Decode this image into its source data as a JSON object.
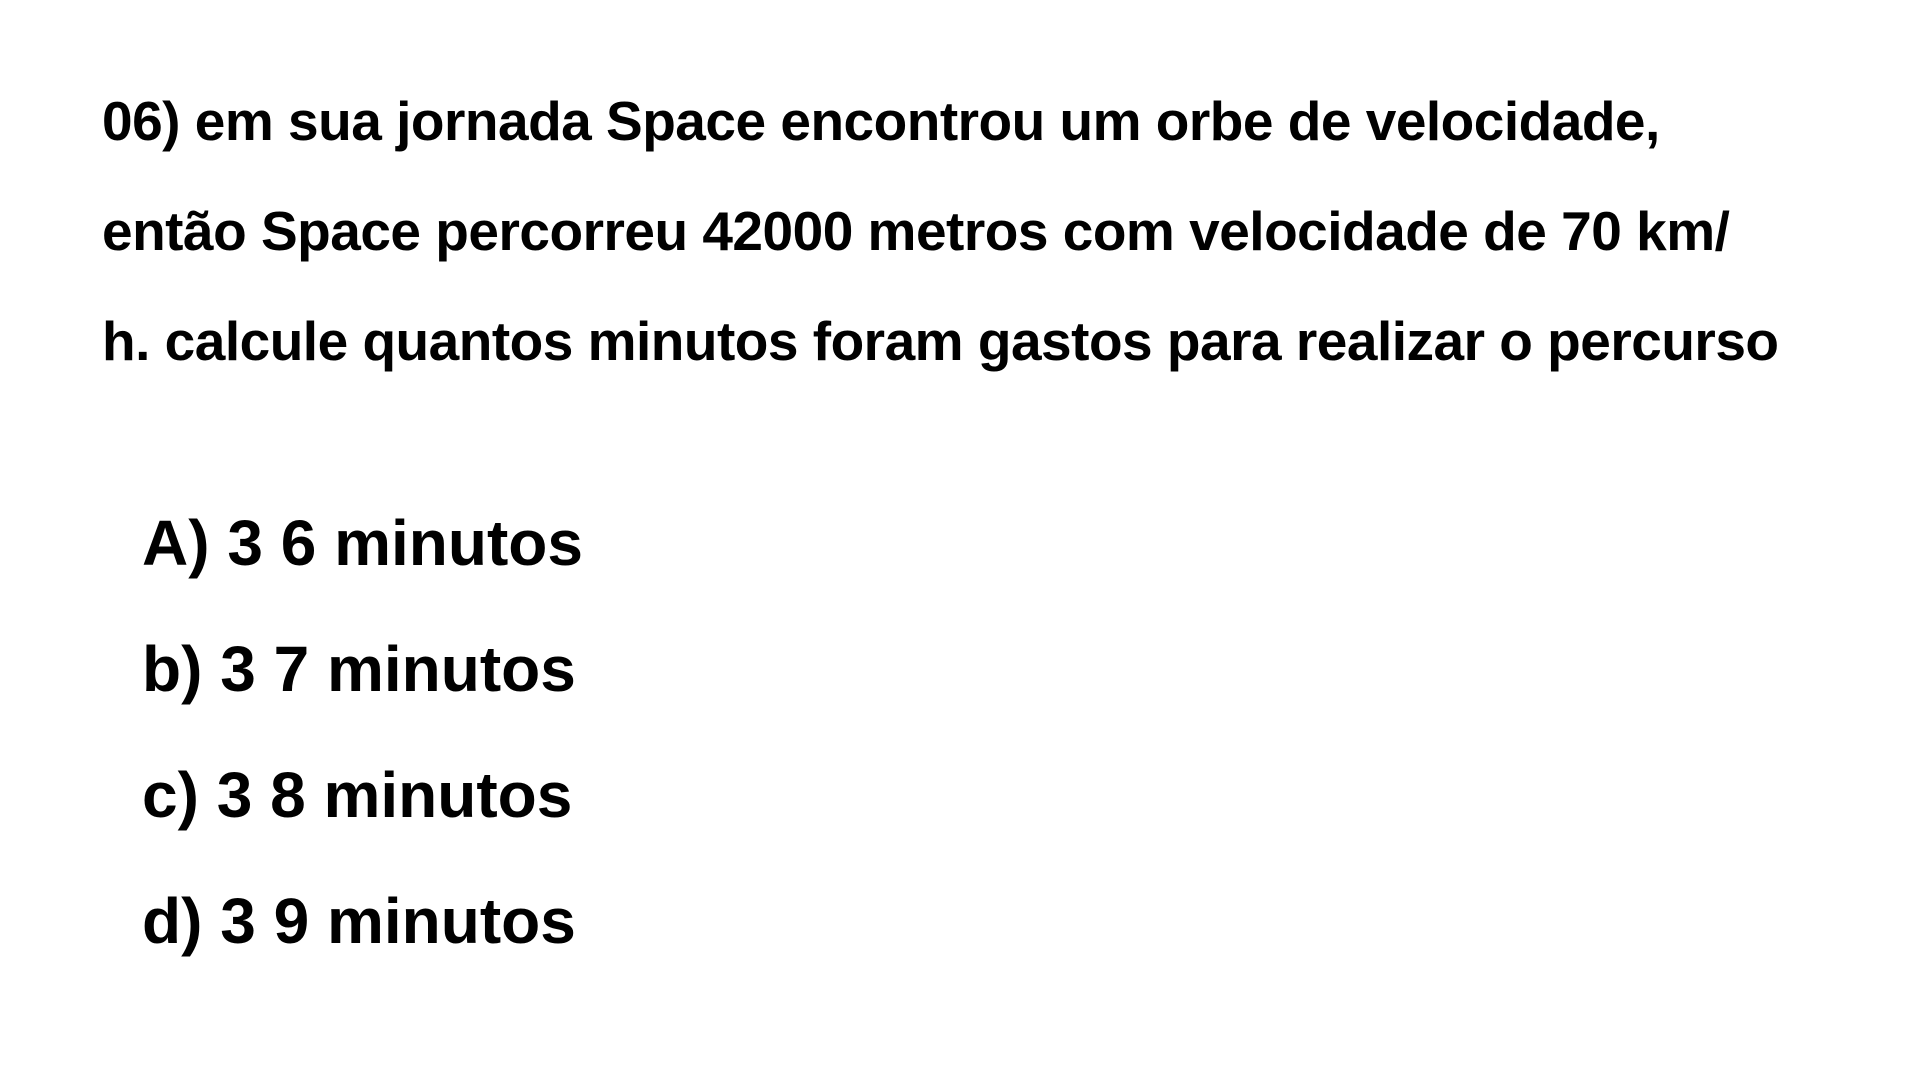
{
  "question": {
    "lines": [
      "06) em sua jornada Space encontrou um orbe de velocidade,",
      "então Space percorreu 42000 metros com velocidade de 70 km/",
      "h. calcule quantos minutos foram gastos para realizar o percurso"
    ]
  },
  "options": [
    "A) 3 6 minutos",
    "b) 3 7 minutos",
    "c) 3 8 minutos",
    "d) 3 9 minutos"
  ]
}
